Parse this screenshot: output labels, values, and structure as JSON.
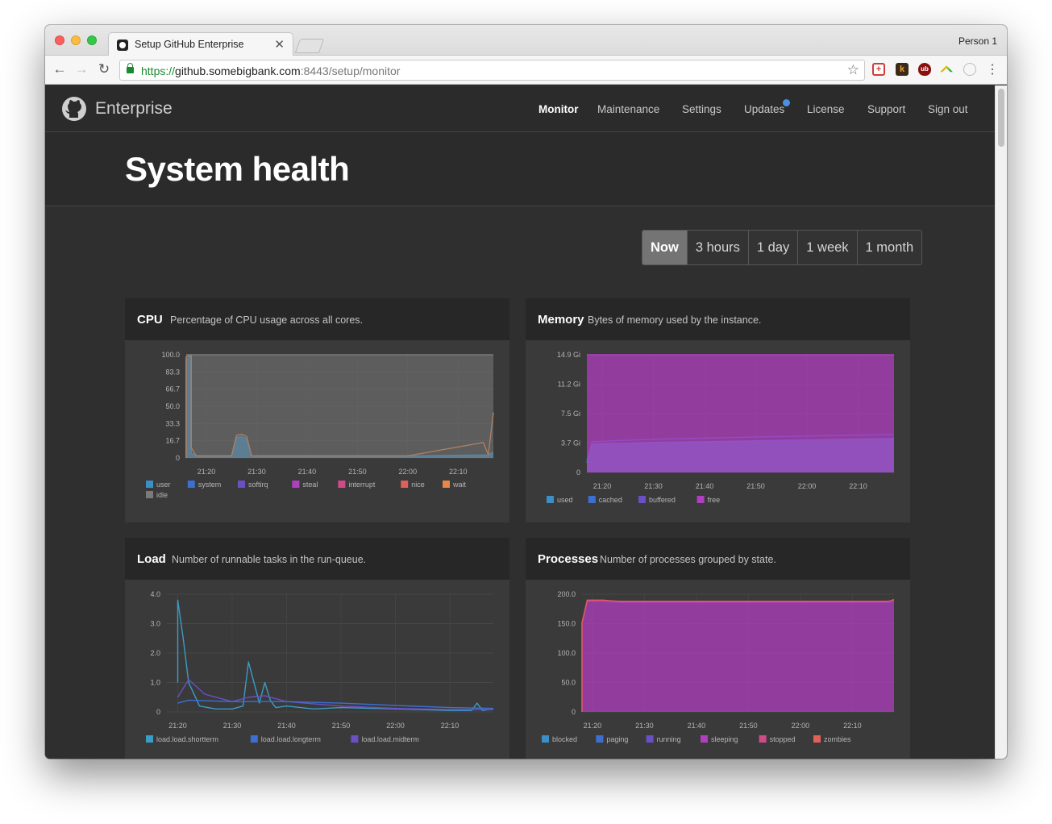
{
  "browser": {
    "tab_title": "Setup GitHub Enterprise",
    "tab_close": "✕",
    "profile": "Person 1",
    "url_scheme": "https://",
    "url_host": "github.somebigbank.com",
    "url_rest": ":8443/setup/monitor",
    "back": "←",
    "forward": "→",
    "reload": "↻",
    "star": "☆",
    "menu": "⋮"
  },
  "nav": {
    "brand": "Enterprise",
    "links": [
      "Monitor",
      "Maintenance",
      "Settings",
      "Updates",
      "License",
      "Support",
      "Sign out"
    ],
    "active": "Monitor",
    "update_dot_color": "#4a90e2"
  },
  "header": {
    "title": "System health"
  },
  "ranges": {
    "items": [
      "Now",
      "3 hours",
      "1 day",
      "1 week",
      "1 month"
    ],
    "active": "Now"
  },
  "panels": {
    "cpu": {
      "title": "CPU",
      "description": "Percentage of CPU usage across all cores."
    },
    "memory": {
      "title": "Memory",
      "description": "Bytes of memory used by the instance."
    },
    "load": {
      "title": "Load",
      "description": "Number of runnable tasks in the run-queue."
    },
    "processes": {
      "title": "Processes",
      "description": "Number of processes grouped by state."
    }
  },
  "chart_data": [
    {
      "id": "cpu",
      "type": "area",
      "x_ticks": [
        "21:20",
        "21:30",
        "21:40",
        "21:50",
        "22:00",
        "22:10"
      ],
      "y_ticks": [
        "0",
        "16.7",
        "33.3",
        "50.0",
        "66.7",
        "83.3",
        "100.0"
      ],
      "ylim": [
        0,
        100
      ],
      "x_range": [
        "21:16",
        "22:17"
      ],
      "legend": [
        {
          "name": "user",
          "color": "#3b8fc4"
        },
        {
          "name": "system",
          "color": "#3d6fd1"
        },
        {
          "name": "softirq",
          "color": "#6b4fc4"
        },
        {
          "name": "steal",
          "color": "#b03fc0"
        },
        {
          "name": "interrupt",
          "color": "#d04a8a"
        },
        {
          "name": "nice",
          "color": "#e0605a"
        },
        {
          "name": "wait",
          "color": "#e8864a"
        },
        {
          "name": "idle",
          "color": "#7a7a7a"
        }
      ],
      "series": [
        {
          "name": "user",
          "x": [
            "21:16",
            "21:16",
            "21:17",
            "21:17",
            "21:18",
            "21:25",
            "21:26",
            "21:27",
            "21:28",
            "21:29",
            "22:00",
            "22:16",
            "22:17"
          ],
          "values": [
            0,
            95,
            100,
            5,
            2,
            2,
            20,
            21,
            19,
            2,
            2,
            3,
            6
          ]
        },
        {
          "name": "wait",
          "x": [
            "21:16",
            "21:16",
            "21:17",
            "21:17",
            "21:18",
            "21:25",
            "21:26",
            "21:27",
            "21:28",
            "21:29",
            "22:00",
            "22:15",
            "22:16",
            "22:17"
          ],
          "values": [
            0,
            98,
            100,
            10,
            2,
            2,
            22,
            23,
            21,
            2,
            2,
            15,
            3,
            44
          ]
        },
        {
          "name": "idle",
          "x": [
            "21:16",
            "22:17"
          ],
          "values": [
            100,
            100
          ]
        }
      ]
    },
    {
      "id": "memory",
      "type": "area",
      "x_ticks": [
        "21:20",
        "21:30",
        "21:40",
        "21:50",
        "22:00",
        "22:10"
      ],
      "y_ticks": [
        "0",
        "3.7 Gi",
        "7.5 Gi",
        "11.2 Gi",
        "14.9 Gi"
      ],
      "ylim": [
        0,
        14.9
      ],
      "x_range": [
        "21:17",
        "22:17"
      ],
      "legend": [
        {
          "name": "used",
          "color": "#3b8fc4"
        },
        {
          "name": "cached",
          "color": "#3d6fd1"
        },
        {
          "name": "buffered",
          "color": "#6b4fc4"
        },
        {
          "name": "free",
          "color": "#b03fc0"
        }
      ],
      "series": [
        {
          "name": "used",
          "x": [
            "21:17",
            "21:18",
            "21:30",
            "21:50",
            "22:17"
          ],
          "values": [
            1.2,
            3.6,
            3.8,
            4.0,
            4.3
          ]
        },
        {
          "name": "cached",
          "x": [
            "21:17",
            "21:18",
            "21:30",
            "21:50",
            "22:17"
          ],
          "values": [
            1.5,
            3.9,
            4.2,
            4.5,
            4.8
          ]
        },
        {
          "name": "free",
          "x": [
            "21:17",
            "22:17"
          ],
          "values": [
            14.9,
            14.9
          ]
        }
      ]
    },
    {
      "id": "load",
      "type": "line",
      "x_ticks": [
        "21:20",
        "21:30",
        "21:40",
        "21:50",
        "22:00",
        "22:10"
      ],
      "y_ticks": [
        "0",
        "1.0",
        "2.0",
        "3.0",
        "4.0"
      ],
      "ylim": [
        0,
        4
      ],
      "x_range": [
        "21:18",
        "22:18"
      ],
      "legend": [
        {
          "name": "load.load.shortterm",
          "color": "#3b9cc4"
        },
        {
          "name": "load.load.longterm",
          "color": "#3d6fd1"
        },
        {
          "name": "load.load.midterm",
          "color": "#6b4fc4"
        }
      ],
      "series": [
        {
          "name": "load.load.shortterm",
          "x": [
            "21:20",
            "21:20",
            "21:21",
            "21:22",
            "21:24",
            "21:27",
            "21:30",
            "21:32",
            "21:33",
            "21:35",
            "21:36",
            "21:37",
            "21:38",
            "21:40",
            "21:45",
            "21:50",
            "22:00",
            "22:10",
            "22:14",
            "22:15",
            "22:16",
            "22:18"
          ],
          "values": [
            1.0,
            3.8,
            2.5,
            1.0,
            0.2,
            0.1,
            0.1,
            0.2,
            1.7,
            0.3,
            1.0,
            0.4,
            0.15,
            0.2,
            0.1,
            0.15,
            0.1,
            0.05,
            0.05,
            0.3,
            0.05,
            0.1
          ]
        },
        {
          "name": "load.load.midterm",
          "x": [
            "21:20",
            "21:22",
            "21:25",
            "21:30",
            "21:33",
            "21:36",
            "21:40",
            "21:50",
            "22:00",
            "22:10",
            "22:18"
          ],
          "values": [
            0.5,
            1.1,
            0.6,
            0.35,
            0.5,
            0.55,
            0.35,
            0.2,
            0.12,
            0.08,
            0.08
          ]
        },
        {
          "name": "load.load.longterm",
          "x": [
            "21:20",
            "21:22",
            "21:30",
            "21:40",
            "21:50",
            "22:00",
            "22:10",
            "22:18"
          ],
          "values": [
            0.3,
            0.4,
            0.35,
            0.35,
            0.3,
            0.22,
            0.15,
            0.12
          ]
        }
      ]
    },
    {
      "id": "processes",
      "type": "area",
      "x_ticks": [
        "21:20",
        "21:30",
        "21:40",
        "21:50",
        "22:00",
        "22:10"
      ],
      "y_ticks": [
        "0",
        "50.0",
        "100.0",
        "150.0",
        "200.0"
      ],
      "ylim": [
        0,
        200
      ],
      "x_range": [
        "21:18",
        "22:18"
      ],
      "legend": [
        {
          "name": "blocked",
          "color": "#3b8fc4"
        },
        {
          "name": "paging",
          "color": "#3d6fd1"
        },
        {
          "name": "running",
          "color": "#6b4fc4"
        },
        {
          "name": "sleeping",
          "color": "#b03fc0"
        },
        {
          "name": "stopped",
          "color": "#d04a8a"
        },
        {
          "name": "zombies",
          "color": "#e0605a"
        }
      ],
      "series": [
        {
          "name": "sleeping",
          "x": [
            "21:18",
            "21:18",
            "21:19",
            "21:22",
            "21:25",
            "22:10",
            "22:17",
            "22:18"
          ],
          "values": [
            0,
            150,
            188,
            188,
            186,
            186,
            186,
            189
          ]
        },
        {
          "name": "zombies",
          "x": [
            "21:18",
            "21:18",
            "21:19",
            "21:22",
            "21:25",
            "22:10",
            "22:17",
            "22:18"
          ],
          "values": [
            0,
            152,
            190,
            190,
            188,
            188,
            188,
            191
          ]
        }
      ]
    }
  ]
}
